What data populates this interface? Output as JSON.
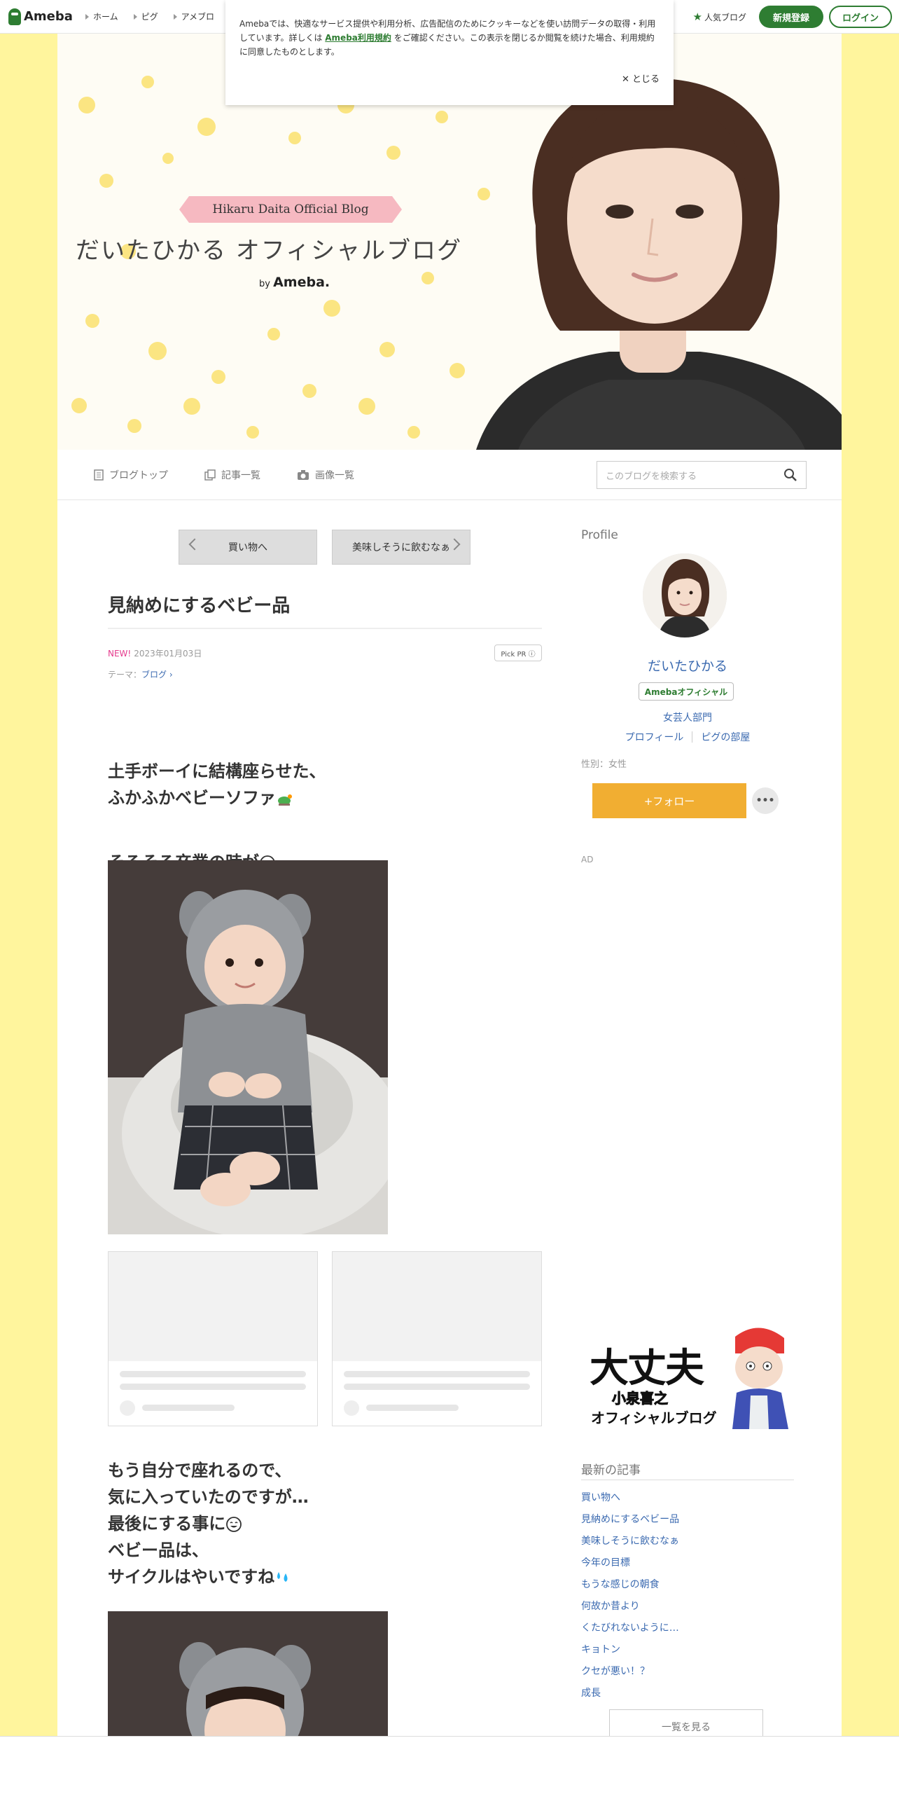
{
  "global_header": {
    "logo": "Ameba",
    "nav": [
      "ホーム",
      "ピグ",
      "アメブロ"
    ],
    "popular": "人気ブログ",
    "signup": "新規登録",
    "login": "ログイン"
  },
  "cookie_notice": {
    "text_before": "Amebaでは、快適なサービス提供や利用分析、広告配信のためにクッキーなどを使い訪問データの取得・利用しています。詳しくは ",
    "link": "Ameba利用規約",
    "text_after": " をご確認ください。この表示を閉じるか閲覧を続けた場合、利用規約に同意したものとします。",
    "close": "✕ とじる"
  },
  "hero": {
    "badge": "Hikaru Daita Official Blog",
    "title": "だいたひかる オフィシャルブログ",
    "by": "by",
    "brand": "Ameba."
  },
  "blog_nav": {
    "items": [
      "ブログトップ",
      "記事一覧",
      "画像一覧"
    ],
    "search_placeholder": "このブログを検索する"
  },
  "article": {
    "prev": "買い物へ",
    "next": "美味しそうに飲むなぁ",
    "title": "見納めにするベビー品",
    "new_label": "NEW!",
    "date": "2023年01月03日",
    "pick_pr": "Pick PR ⓘ",
    "theme_label": "テーマ：",
    "theme": "ブログ ›",
    "para1_line1": "土手ボーイに結構座らせた、",
    "para1_line2": "ふかふかベビーソファ",
    "para2": "そろそろ卒業の時が",
    "para3_line1": "もう自分で座れるので、",
    "para3_line2": "気に入っていたのですが…",
    "para3_line3": "最後にする事に",
    "para3_line4": "ベビー品は、",
    "para3_line5": "サイクルはやいですね"
  },
  "sidebar": {
    "profile_title": "Profile",
    "name": "だいたひかる",
    "official": "Amebaオフィシャル",
    "genre": "女芸人部門",
    "link_profile": "プロフィール",
    "link_pig": "ピグの部屋",
    "gender": "性別：女性",
    "follow": "+フォロー",
    "more": "•••",
    "ad": "AD",
    "banner_line1": "大丈夫",
    "banner_line2": "小泉喜之",
    "banner_line3": "オフィシャルブログ",
    "recent_title": "最新の記事",
    "recent": [
      "買い物へ",
      "見納めにするベビー品",
      "美味しそうに飲むなぁ",
      "今年の目標",
      "もうな感じの朝食",
      "何故か昔より",
      "くたびれないように…",
      "キョトン",
      "クセが悪い！？",
      "成長"
    ],
    "see_all": "一覧を見る"
  },
  "colors": {
    "accent_green": "#2e7d32",
    "follow_orange": "#f1ae32",
    "link_blue": "#3b6ab0",
    "bg_yellow": "#fff59d",
    "badge_pink": "#f6b9c1"
  }
}
